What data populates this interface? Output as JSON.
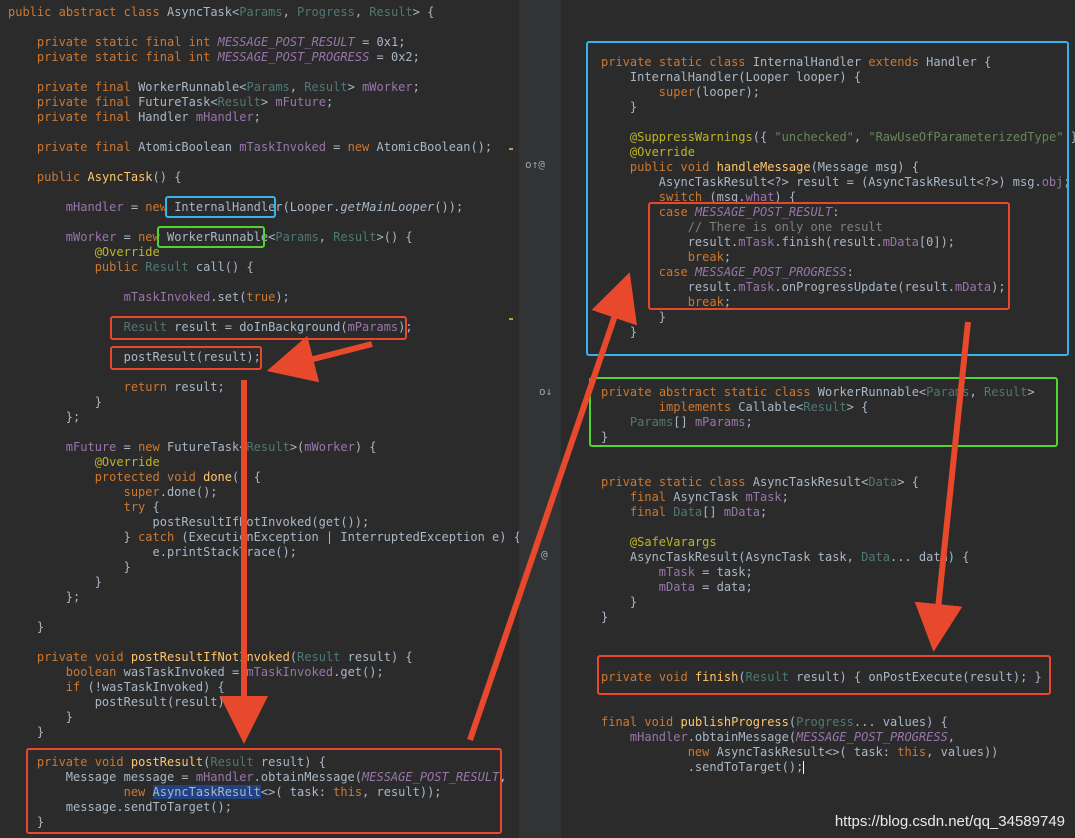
{
  "left_code": [
    "public abstract class AsyncTask<Params, Progress, Result> {",
    "",
    "    private static final int MESSAGE_POST_RESULT = 0x1;",
    "    private static final int MESSAGE_POST_PROGRESS = 0x2;",
    "",
    "    private final WorkerRunnable<Params, Result> mWorker;",
    "    private final FutureTask<Result> mFuture;",
    "    private final Handler mHandler;",
    "",
    "    private final AtomicBoolean mTaskInvoked = new AtomicBoolean();",
    "",
    "    public AsyncTask() {",
    "",
    "        mHandler = new InternalHandler(Looper.getMainLooper());",
    "",
    "        mWorker = new WorkerRunnable<Params, Result>() {",
    "            @Override",
    "            public Result call() {",
    "",
    "                mTaskInvoked.set(true);",
    "",
    "                Result result = doInBackground(mParams);",
    "",
    "                postResult(result);",
    "",
    "                return result;",
    "            }",
    "        };",
    "",
    "        mFuture = new FutureTask<Result>(mWorker) {",
    "            @Override",
    "            protected void done() {",
    "                super.done();",
    "                try {",
    "                    postResultIfNotInvoked(get());",
    "                } catch (ExecutionException | InterruptedException e) {",
    "                    e.printStackTrace();",
    "                }",
    "            }",
    "        };",
    "",
    "    }",
    "",
    "    private void postResultIfNotInvoked(Result result) {",
    "        boolean wasTaskInvoked = mTaskInvoked.get();",
    "        if (!wasTaskInvoked) {",
    "            postResult(result);",
    "        }",
    "    }",
    "",
    "    private void postResult(Result result) {",
    "        Message message = mHandler.obtainMessage(MESSAGE_POST_RESULT,",
    "                new AsyncTaskResult<>( task: this, result));",
    "        message.sendToTarget();",
    "    }"
  ],
  "right_code": {
    "internal_handler": [
      "private static class InternalHandler extends Handler {",
      "    InternalHandler(Looper looper) {",
      "        super(looper);",
      "    }",
      "",
      "    @SuppressWarnings({ \"unchecked\", \"RawUseOfParameterizedType\" })",
      "    @Override",
      "    public void handleMessage(Message msg) {",
      "        AsyncTaskResult<?> result = (AsyncTaskResult<?>) msg.obj;",
      "        switch (msg.what) {",
      "        case MESSAGE_POST_RESULT:",
      "            // There is only one result",
      "            result.mTask.finish(result.mData[0]);",
      "            break;",
      "        case MESSAGE_POST_PROGRESS:",
      "            result.mTask.onProgressUpdate(result.mData);",
      "            break;",
      "        }",
      "    }"
    ],
    "worker_runnable": [
      "private abstract static class WorkerRunnable<Params, Result>",
      "        implements Callable<Result> {",
      "    Params[] mParams;",
      "}"
    ],
    "async_task_result": [
      "private static class AsyncTaskResult<Data> {",
      "    final AsyncTask mTask;",
      "    final Data[] mData;",
      "",
      "    @SafeVarargs",
      "    AsyncTaskResult(AsyncTask task, Data... data) {",
      "        mTask = task;",
      "        mData = data;",
      "    }",
      "}"
    ],
    "finish": "private void finish(Result result) { onPostExecute(result); }",
    "publish_progress": [
      "final void publishProgress(Progress... values) {",
      "    mHandler.obtainMessage(MESSAGE_POST_PROGRESS,",
      "            new AsyncTaskResult<>( task: this, values))",
      "            .sendToTarget();"
    ]
  },
  "watermark": "https://blog.csdn.net/qq_34589749",
  "colors": {
    "background": "#2b2b2b",
    "keyword": "#cc7832",
    "highlight_red": "#e8482c",
    "highlight_blue": "#35b4ec",
    "highlight_green": "#53d330"
  },
  "icons": [
    "override-marker-icon",
    "implemented-marker-icon",
    "annotation-marker-icon"
  ]
}
